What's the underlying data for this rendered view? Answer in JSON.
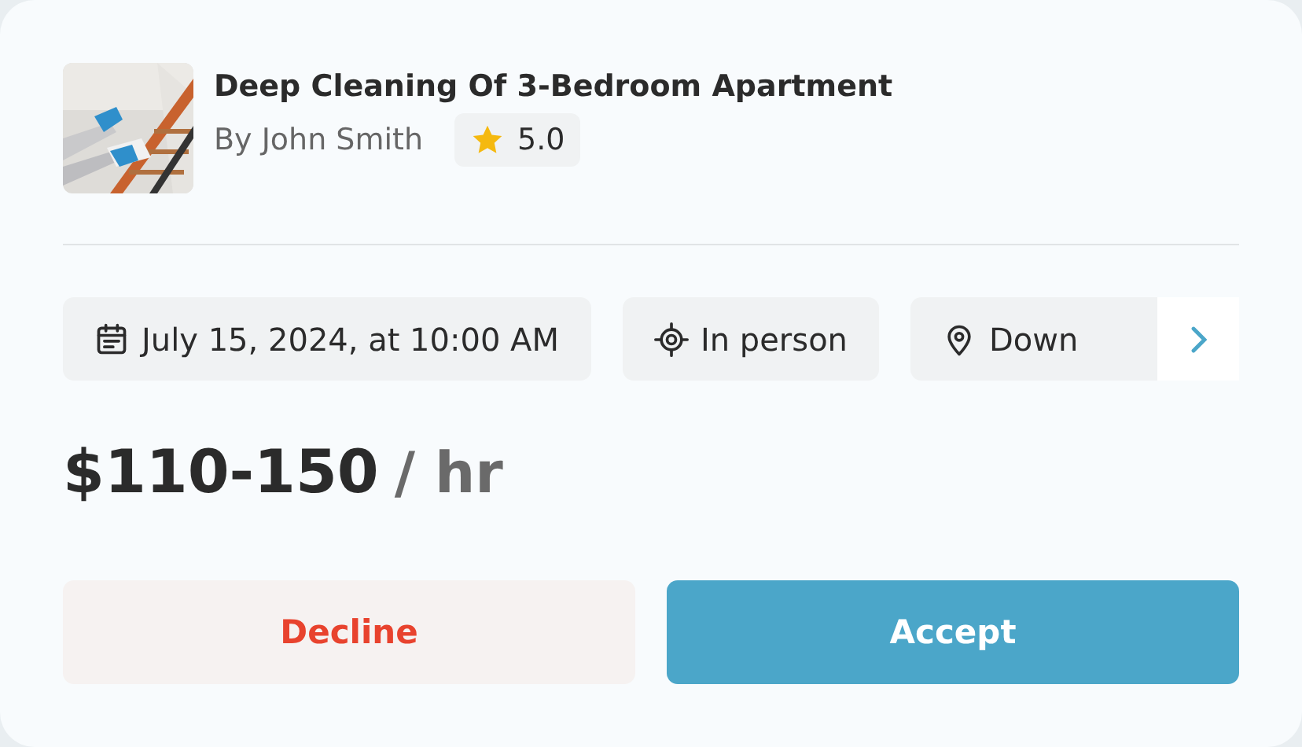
{
  "job": {
    "title": "Deep Cleaning Of 3-Bedroom Apartment",
    "author": "By John Smith",
    "rating": "5.0"
  },
  "chips": [
    {
      "kind": "calendar",
      "label": "July 15, 2024, at 10:00 AM"
    },
    {
      "kind": "target",
      "label": "In person"
    },
    {
      "kind": "pin",
      "label": "Down"
    }
  ],
  "price": {
    "amount": "$110-150",
    "unit": "/ hr"
  },
  "buttons": [
    {
      "kind": "decline",
      "label": "Decline"
    },
    {
      "kind": "accept",
      "label": "Accept"
    }
  ]
}
